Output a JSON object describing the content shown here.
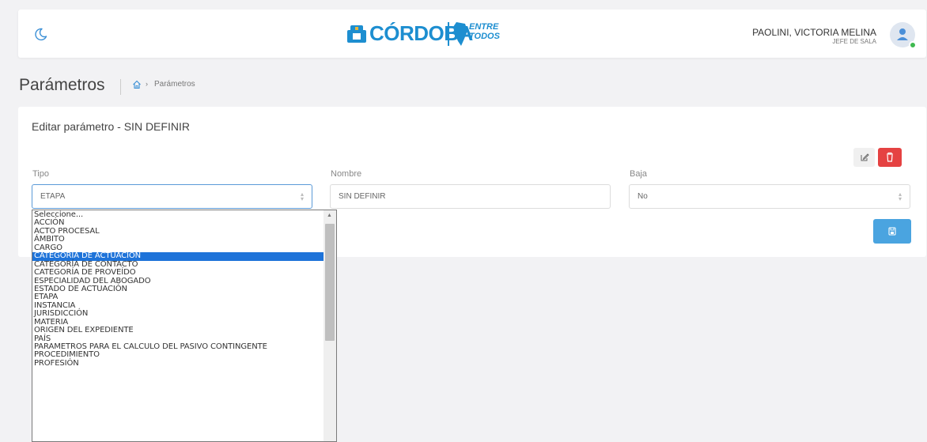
{
  "header": {
    "logo_text": "CÓRDOBA",
    "logo_entre": "ENTRE",
    "logo_todos": "TODOS",
    "user_name": "PAOLINI, VICTORIA MELINA",
    "user_role": "JEFE DE SALA"
  },
  "page": {
    "title": "Parámetros",
    "breadcrumb_arrow": "›",
    "breadcrumb": "Parámetros"
  },
  "form": {
    "title": "Editar parámetro - SIN DEFINIR",
    "tipo_label": "Tipo",
    "tipo_value": "ETAPA",
    "nombre_label": "Nombre",
    "nombre_value": "SIN DEFINIR",
    "baja_label": "Baja",
    "baja_value": "No"
  },
  "dropdown": {
    "options": [
      "Seleccione...",
      "ACCIÓN",
      "ACTO PROCESAL",
      "ÁMBITO",
      "CARGO",
      "CATEGORÍA DE ACTUACIÓN",
      "CATEGORÍA DE CONTACTO",
      "CATEGORÍA DE PROVEÍDO",
      "ESPECIALIDAD DEL ABOGADO",
      "ESTADO DE ACTUACIÓN",
      "ETAPA",
      "INSTANCIA",
      "JURISDICCIÓN",
      "MATERIA",
      "ORIGEN DEL EXPEDIENTE",
      "PAÍS",
      "PARAMETROS PARA EL CALCULO DEL PASIVO CONTINGENTE",
      "PROCEDIMIENTO",
      "PROFESIÓN"
    ],
    "highlighted": "CATEGORÍA DE ACTUACIÓN"
  },
  "colors": {
    "accent": "#1d8ed0",
    "danger": "#e54242",
    "primary": "#4aa4e0",
    "highlight": "#1e73d9"
  }
}
